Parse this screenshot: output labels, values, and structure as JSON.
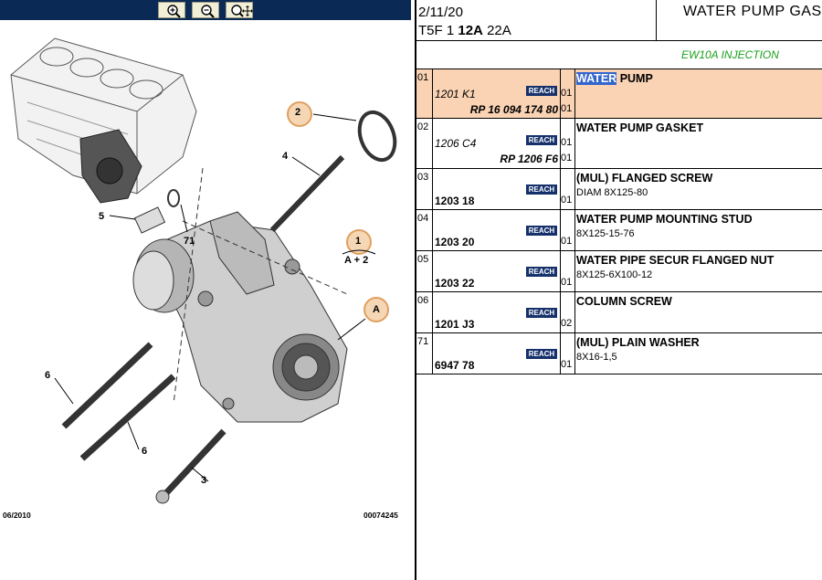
{
  "toolbar": {
    "zoom_in_icon": "magnifier-plus-icon",
    "zoom_out_icon": "magnifier-minus-icon",
    "pan_zoom_icon": "magnifier-move-icon"
  },
  "header": {
    "date": "2/11/20",
    "code_prefix": "T5F 1",
    "code_bold": "12A",
    "code_suffix": "22A",
    "title": "WATER PUMP GAS",
    "engine": "EW10A INJECTION"
  },
  "diagram": {
    "callouts": [
      "2",
      "4",
      "5",
      "71",
      "1",
      "A + 2",
      "A",
      "6",
      "6",
      "3"
    ],
    "footer_left": "06/2010",
    "footer_right": "00074245"
  },
  "parts": [
    {
      "num": "01",
      "ref": "1201 K1",
      "rp": "RP 16 094 174 80",
      "qty": "01",
      "qty2": "01",
      "desc_hl": "WATER",
      "desc": " PUMP",
      "spec": "",
      "reach": "REACH"
    },
    {
      "num": "02",
      "ref": "1206 C4",
      "rp": "RP 1206 F6",
      "qty": "01",
      "qty2": "01",
      "desc_hl": "",
      "desc": "WATER PUMP GASKET",
      "spec": "",
      "reach": "REACH"
    },
    {
      "num": "03",
      "ref": "1203 18",
      "rp": "",
      "qty": "01",
      "qty2": "",
      "desc_hl": "",
      "desc": "(MUL) FLANGED SCREW",
      "spec": "DIAM 8X125-80",
      "reach": "REACH"
    },
    {
      "num": "04",
      "ref": "1203 20",
      "rp": "",
      "qty": "01",
      "qty2": "",
      "desc_hl": "",
      "desc": "WATER PUMP MOUNTING STUD",
      "spec": "8X125-15-76",
      "reach": "REACH"
    },
    {
      "num": "05",
      "ref": "1203 22",
      "rp": "",
      "qty": "01",
      "qty2": "",
      "desc_hl": "",
      "desc": "WATER PIPE SECUR FLANGED NUT",
      "spec": "8X125-6X100-12",
      "reach": "REACH"
    },
    {
      "num": "06",
      "ref": "1201 J3",
      "rp": "",
      "qty": "02",
      "qty2": "",
      "desc_hl": "",
      "desc": "COLUMN SCREW",
      "spec": "",
      "reach": "REACH"
    },
    {
      "num": "71",
      "ref": "6947 78",
      "rp": "",
      "qty": "01",
      "qty2": "",
      "desc_hl": "",
      "desc": "(MUL) PLAIN WASHER",
      "spec": "8X16-1,5",
      "reach": "REACH"
    }
  ]
}
